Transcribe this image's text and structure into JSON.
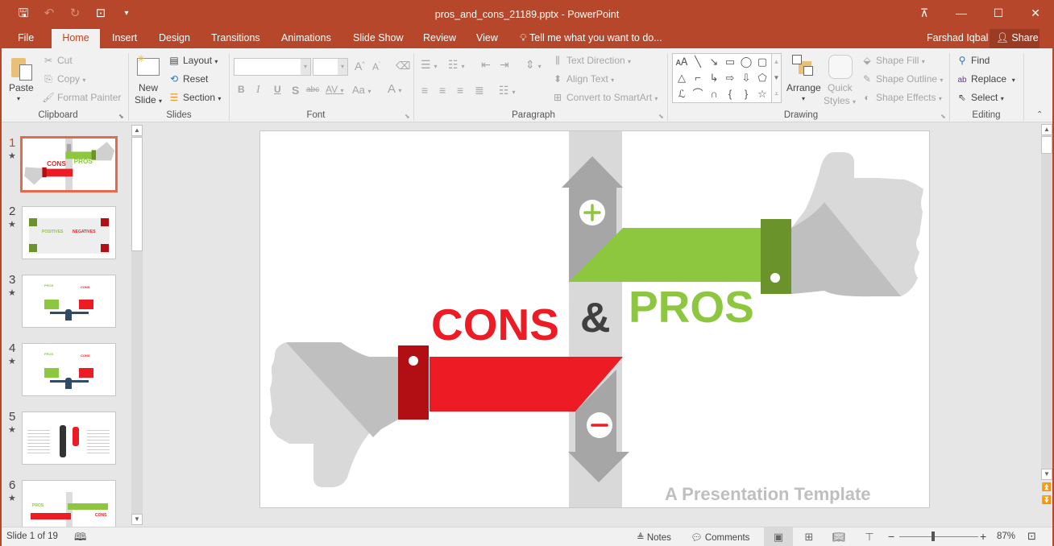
{
  "window": {
    "title": "pros_and_cons_21189.pptx - PowerPoint",
    "qat": {
      "save": "save-icon",
      "undo": "undo-icon",
      "redo": "redo-icon",
      "start_from_beginning": "slideshow-icon",
      "customize": "customize-qat-icon"
    },
    "controls": [
      "ribbon-display-options-icon",
      "minimize-icon",
      "maximize-icon",
      "close-icon"
    ]
  },
  "tabs": [
    {
      "label": "File"
    },
    {
      "label": "Home"
    },
    {
      "label": "Insert"
    },
    {
      "label": "Design"
    },
    {
      "label": "Transitions"
    },
    {
      "label": "Animations"
    },
    {
      "label": "Slide Show"
    },
    {
      "label": "Review"
    },
    {
      "label": "View"
    }
  ],
  "tell_me": "Tell me what you want to do...",
  "user": "Farshad Iqbal",
  "share": "Share",
  "ribbon": {
    "clipboard": {
      "label": "Clipboard",
      "paste": "Paste",
      "cut": "Cut",
      "copy": "Copy",
      "format_painter": "Format Painter"
    },
    "slides": {
      "label": "Slides",
      "new_slide_1": "New",
      "new_slide_2": "Slide",
      "layout": "Layout",
      "reset": "Reset",
      "section": "Section"
    },
    "font": {
      "label": "Font",
      "font_name": "",
      "font_size": "",
      "bold": "B",
      "italic": "I",
      "underline": "U",
      "shadow": "S",
      "strike": "abc",
      "spacing": "AV",
      "case": "Aa",
      "grow": "A",
      "shrink": "A",
      "color": "A"
    },
    "paragraph": {
      "label": "Paragraph",
      "text_direction": "Text Direction",
      "align_text": "Align Text",
      "smartart": "Convert to SmartArt"
    },
    "drawing": {
      "label": "Drawing",
      "arrange": "Arrange",
      "quick_styles_1": "Quick",
      "quick_styles_2": "Styles",
      "shape_fill": "Shape Fill",
      "shape_outline": "Shape Outline",
      "shape_effects": "Shape Effects"
    },
    "editing": {
      "label": "Editing",
      "find": "Find",
      "replace": "Replace",
      "select": "Select"
    }
  },
  "thumbnails": [
    {
      "num": "1",
      "title": "CONS & PROS",
      "active": true
    },
    {
      "num": "2",
      "left": "POSITIVES",
      "right": "NEGATIVES"
    },
    {
      "num": "3",
      "left": "PROS",
      "right": "CONS"
    },
    {
      "num": "4",
      "left": "PROS",
      "right": "CONS"
    },
    {
      "num": "5"
    },
    {
      "num": "6",
      "left": "PROS",
      "right": "CONS"
    }
  ],
  "slide": {
    "cons": "CONS",
    "amp": "&",
    "pros": "PROS",
    "subtitle": "A Presentation Template",
    "colors": {
      "green": "#8dc63f",
      "dark_green": "#6a942b",
      "red": "#ed1c24",
      "dark_red": "#b10f14",
      "gray": "#a6a6a6",
      "light_gray": "#d9d9d9",
      "amp": "#404040",
      "subtitle": "#bfbfbf"
    }
  },
  "status": {
    "slide_info": "Slide 1 of 19",
    "notes": "Notes",
    "comments": "Comments",
    "zoom": "87%"
  }
}
